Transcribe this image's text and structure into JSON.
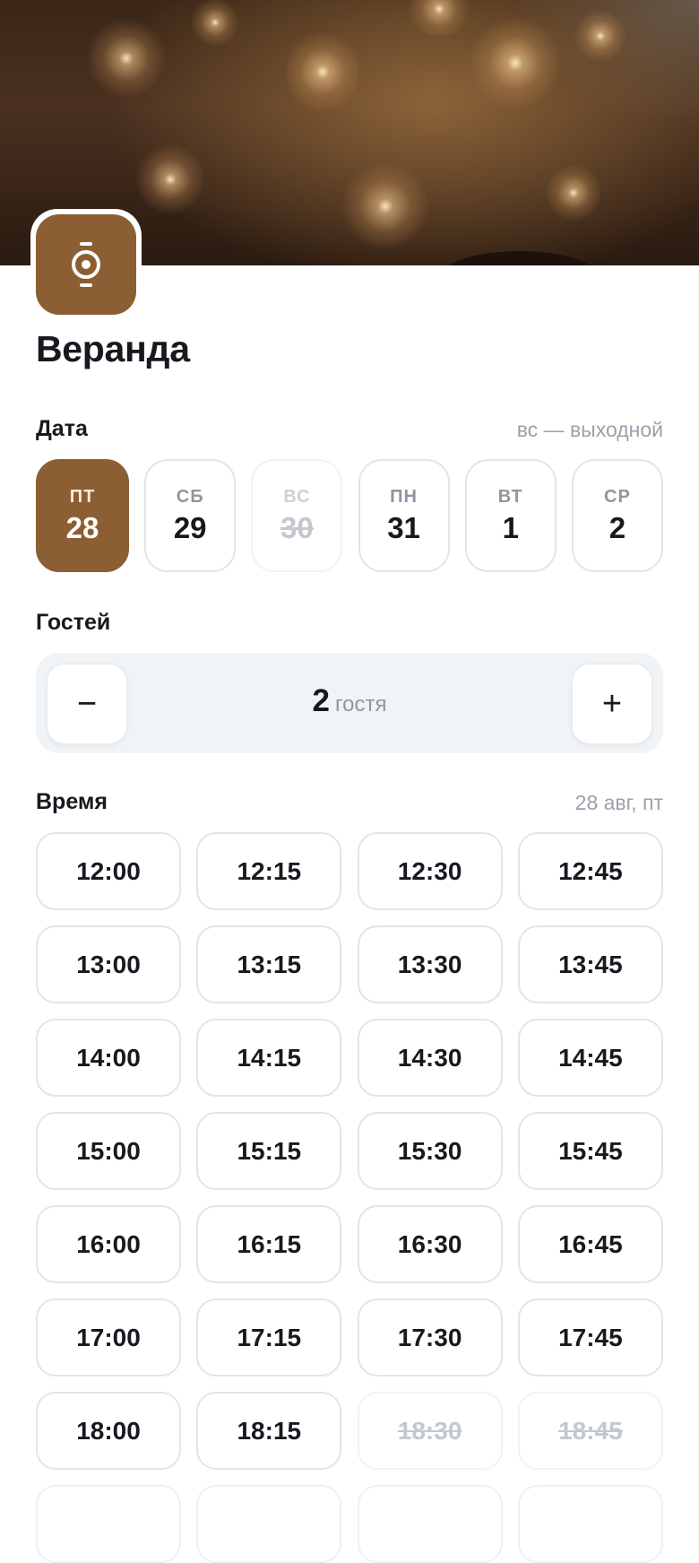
{
  "venue": {
    "title": "Веранда",
    "accent": "#8b5e34",
    "logo_icon": "clock-icon"
  },
  "date_section": {
    "label": "Дата",
    "note": "вс — выходной"
  },
  "dates": [
    {
      "dow": "ПТ",
      "day": "28",
      "state": "selected"
    },
    {
      "dow": "СБ",
      "day": "29",
      "state": "normal"
    },
    {
      "dow": "ВС",
      "day": "30",
      "state": "disabled"
    },
    {
      "dow": "ПН",
      "day": "31",
      "state": "normal"
    },
    {
      "dow": "ВТ",
      "day": "1",
      "state": "normal"
    },
    {
      "dow": "СР",
      "day": "2",
      "state": "normal"
    }
  ],
  "guests": {
    "label": "Гостей",
    "value": "2",
    "unit": "гостя",
    "minus": "−",
    "plus": "+"
  },
  "time_section": {
    "label": "Время",
    "note": "28 авг, пт"
  },
  "slots": [
    {
      "time": "12:00",
      "state": "available"
    },
    {
      "time": "12:15",
      "state": "available"
    },
    {
      "time": "12:30",
      "state": "available"
    },
    {
      "time": "12:45",
      "state": "available"
    },
    {
      "time": "13:00",
      "state": "available"
    },
    {
      "time": "13:15",
      "state": "available"
    },
    {
      "time": "13:30",
      "state": "available"
    },
    {
      "time": "13:45",
      "state": "available"
    },
    {
      "time": "14:00",
      "state": "available"
    },
    {
      "time": "14:15",
      "state": "available"
    },
    {
      "time": "14:30",
      "state": "available"
    },
    {
      "time": "14:45",
      "state": "available"
    },
    {
      "time": "15:00",
      "state": "available"
    },
    {
      "time": "15:15",
      "state": "available"
    },
    {
      "time": "15:30",
      "state": "available"
    },
    {
      "time": "15:45",
      "state": "available"
    },
    {
      "time": "16:00",
      "state": "available"
    },
    {
      "time": "16:15",
      "state": "available"
    },
    {
      "time": "16:30",
      "state": "available"
    },
    {
      "time": "16:45",
      "state": "available"
    },
    {
      "time": "17:00",
      "state": "available"
    },
    {
      "time": "17:15",
      "state": "available"
    },
    {
      "time": "17:30",
      "state": "available"
    },
    {
      "time": "17:45",
      "state": "available"
    },
    {
      "time": "18:00",
      "state": "available"
    },
    {
      "time": "18:15",
      "state": "available"
    },
    {
      "time": "18:30",
      "state": "disabled"
    },
    {
      "time": "18:45",
      "state": "disabled"
    }
  ]
}
